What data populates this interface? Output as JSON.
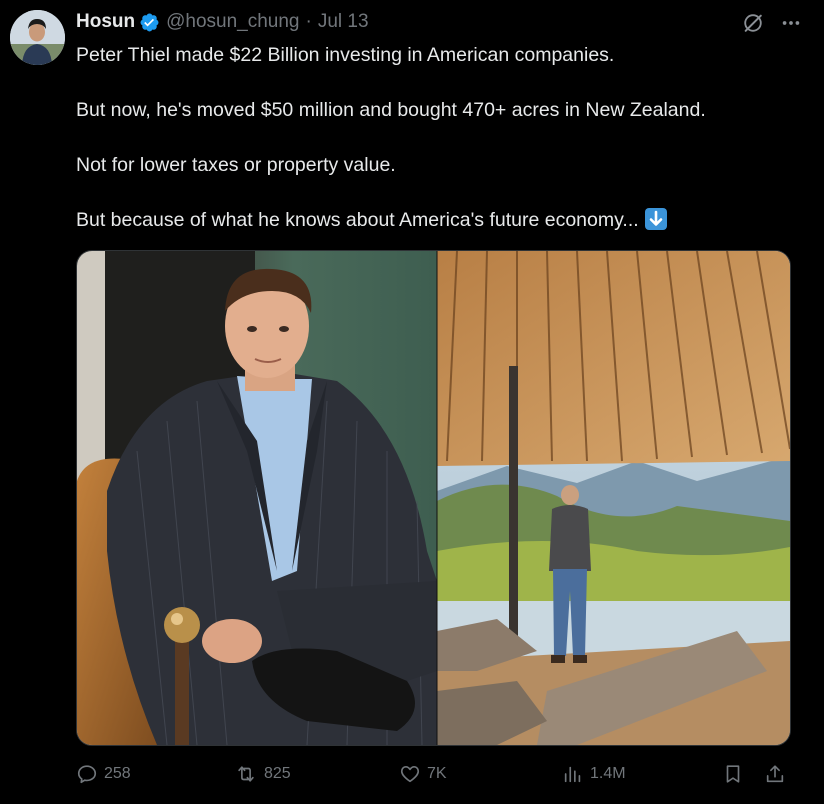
{
  "tweet": {
    "author": {
      "display_name": "Hosun",
      "handle": "@hosun_chung",
      "verified": true
    },
    "separator": "·",
    "date": "Jul 13",
    "paragraphs": [
      "Peter Thiel made $22 Billion investing in American companies.",
      "But now, he's moved $50 million and bought 470+ acres in New Zealand.",
      "Not for lower taxes or property value.",
      "But because of what he knows about America's future economy..."
    ],
    "trailing_emoji": "down-arrow-emoji"
  },
  "media": {
    "left_panel": "portrait-of-man-in-pinstripe-suit-seated-in-leather-chair",
    "right_panel": "man-standing-under-wooden-slatted-roof-overlooking-mountains"
  },
  "actions": {
    "replies": "258",
    "reposts": "825",
    "likes": "7K",
    "views": "1.4M"
  },
  "colors": {
    "background": "#000000",
    "text_primary": "#e7e9ea",
    "text_secondary": "#71767b",
    "verified_blue": "#1d9bf0",
    "emoji_blue": "#3b94d9"
  }
}
